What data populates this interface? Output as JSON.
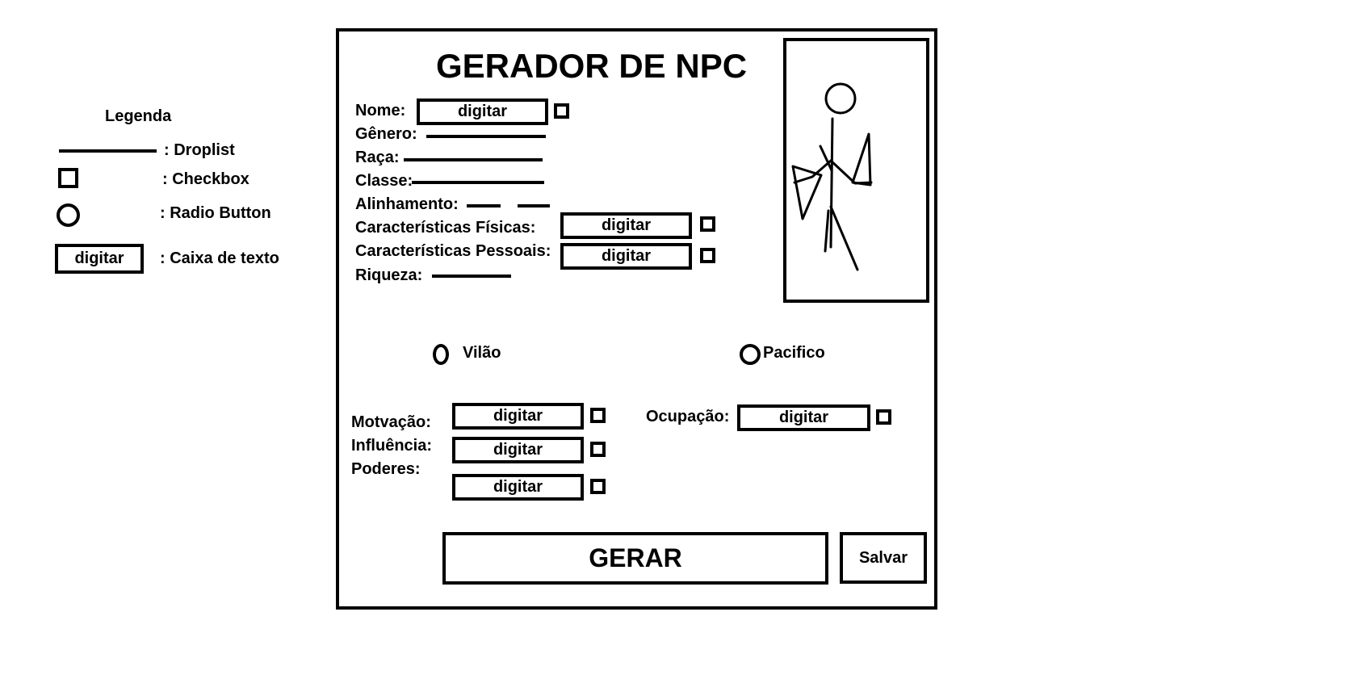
{
  "legend": {
    "title": "Legenda",
    "droplist": ": Droplist",
    "checkbox": ": Checkbox",
    "radio": ": Radio Button",
    "textbox_sample": "digitar",
    "textbox": ": Caixa de texto"
  },
  "form": {
    "title": "GERADOR DE NPC",
    "nome_label": "Nome:",
    "nome_value": "digitar",
    "genero_label": "Gênero:",
    "raca_label": "Raça:",
    "classe_label": "Classe:",
    "alinhamento_label": "Alinhamento:",
    "fisicas_label": "Características Físicas:",
    "fisicas_value": "digitar",
    "pessoais_label": "Características Pessoais:",
    "pessoais_value": "digitar",
    "riqueza_label": "Riqueza:",
    "vilao_label": "Vilão",
    "pacifico_label": "Pacifico",
    "motivacao_label": "Motvação:",
    "motivacao_value": "digitar",
    "influencia_label": "Influência:",
    "influencia_value": "digitar",
    "poderes_label": "Poderes:",
    "poderes_value": "digitar",
    "ocupacao_label": "Ocupação:",
    "ocupacao_value": "digitar",
    "gerar_label": "GERAR",
    "salvar_label": "Salvar"
  }
}
